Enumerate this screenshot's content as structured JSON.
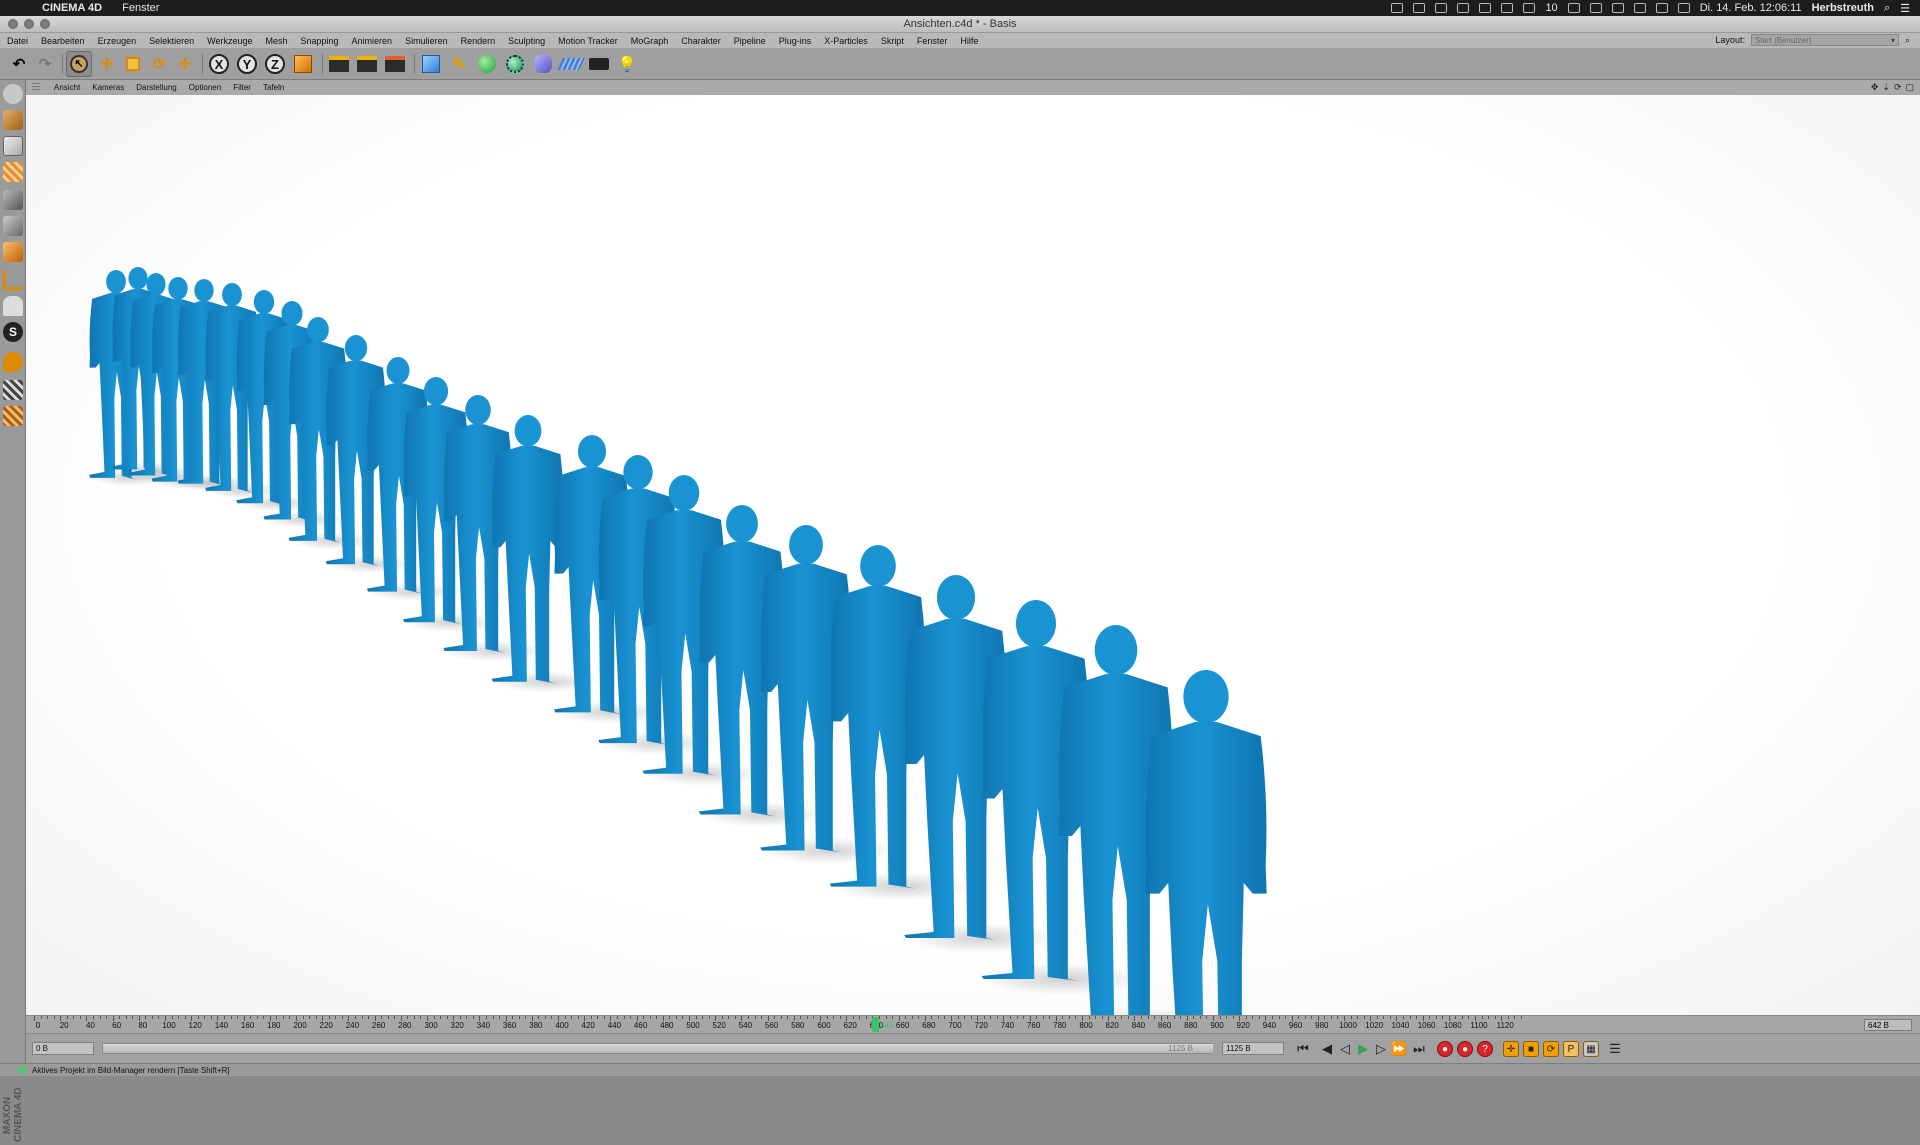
{
  "macos_menubar": {
    "apple_icon": "apple-logo",
    "app_name": "CINEMA 4D",
    "menu": [
      "Fenster"
    ],
    "date_time": "Di. 14. Feb. 12:06:11",
    "user": "Herbstreuth",
    "badge_count": "10"
  },
  "window": {
    "title": "Ansichten.c4d * - Basis"
  },
  "app_menu": {
    "items": [
      "Datei",
      "Bearbeiten",
      "Erzeugen",
      "Selektieren",
      "Werkzeuge",
      "Mesh",
      "Snapping",
      "Animieren",
      "Simulieren",
      "Rendern",
      "Sculpting",
      "Motion Tracker",
      "MoGraph",
      "Charakter",
      "Pipeline",
      "Plug-ins",
      "X-Particles",
      "Skript",
      "Fenster",
      "Hilfe"
    ],
    "layout_label": "Layout:",
    "layout_value": "Start (Benutzer)"
  },
  "toolbar": {
    "undo_icon": "undo-icon",
    "redo_icon": "redo-icon",
    "x_label": "X",
    "y_label": "Y",
    "z_label": "Z"
  },
  "viewport_menu": {
    "items": [
      "Ansicht",
      "Kameras",
      "Darstellung",
      "Optionen",
      "Filter",
      "Tafeln"
    ],
    "controls": [
      "✥",
      "⇣",
      "⟳",
      "▢"
    ]
  },
  "timeline": {
    "ruler_labels": [
      "0",
      "20",
      "40",
      "60",
      "80",
      "100",
      "120",
      "140",
      "160",
      "180",
      "200",
      "220",
      "240",
      "260",
      "280",
      "300",
      "320",
      "340",
      "360",
      "380",
      "400",
      "420",
      "440",
      "460",
      "480",
      "500",
      "520",
      "540",
      "560",
      "580",
      "600",
      "620",
      "640",
      "660",
      "680",
      "700",
      "720",
      "740",
      "760",
      "780",
      "800",
      "820",
      "840",
      "860",
      "880",
      "900",
      "920",
      "940",
      "960",
      "980",
      "1000",
      "1020",
      "1040",
      "1060",
      "1080",
      "1100",
      "1120"
    ],
    "current_frame_label": "642",
    "current_frame": 642,
    "end_frame_field": "642 B"
  },
  "transport": {
    "start_field": "0 B",
    "slider_start": "0 B",
    "slider_end": "1125 B",
    "end_field": "1125 B"
  },
  "status_bar": {
    "message": "Aktives Projekt im Bild-Manager rendern [Taste Shift+R]"
  },
  "colors": {
    "figure_blue": "#1a93d3",
    "figure_shade": "#0f75b0",
    "viewport_bg": "#ffffff"
  },
  "maxon_logo": "MAXON CINEMA 4D"
}
